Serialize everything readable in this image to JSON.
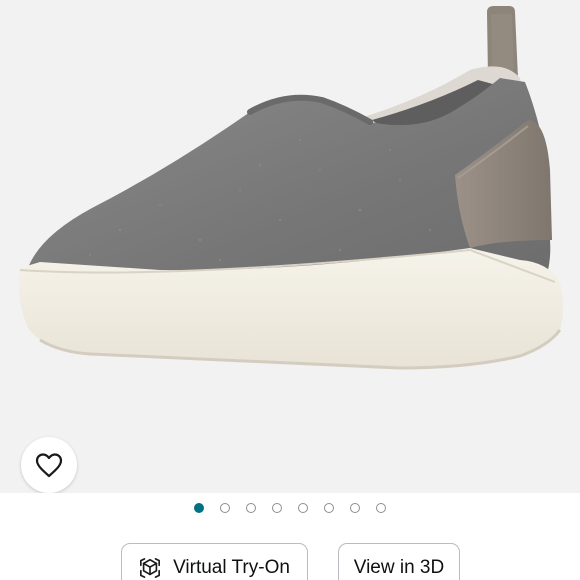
{
  "product": {
    "image_icon": "slip-on-sneaker-image",
    "colors": {
      "background": "#f2f2f2",
      "upper": "#7e7e7e",
      "heel_tab": "#8f857b",
      "sole": "#f1ede3"
    }
  },
  "gallery": {
    "total_images": 8,
    "active_index": 0,
    "accent_color": "#007185"
  },
  "wishlist": {
    "icon": "heart-icon"
  },
  "actions": {
    "virtual_try_on_label": "Virtual Try-On",
    "virtual_try_on_icon": "ar-cube-icon",
    "view_3d_label": "View in 3D"
  }
}
